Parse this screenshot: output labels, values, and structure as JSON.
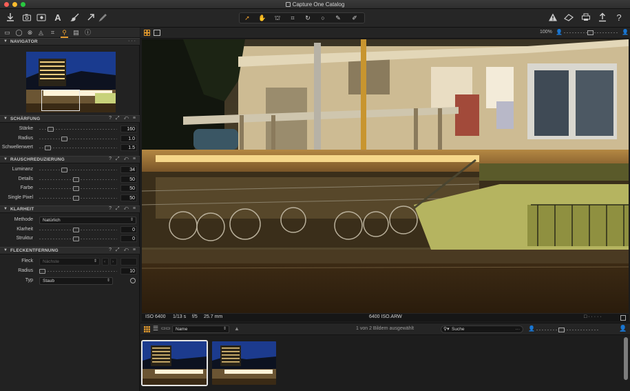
{
  "window": {
    "title": "Capture One Catalog"
  },
  "toolbar": {
    "left_icons": [
      "import-icon",
      "camera-icon",
      "capture-icon",
      "text-icon",
      "brush-icon",
      "arrow-icon",
      "pipette-icon"
    ],
    "center_tools": [
      "select-icon",
      "hand-icon",
      "straighten-icon",
      "crop-icon",
      "rotate-icon",
      "circle-icon",
      "picker-icon",
      "brush-tool-icon"
    ],
    "right_icons": [
      "warning-icon",
      "eraser-icon",
      "print-icon",
      "share-icon",
      "help-icon"
    ]
  },
  "left_panel": {
    "tab_icons": [
      "folder-icon",
      "capture-tab-icon",
      "color-icon",
      "exposure-icon",
      "lens-icon",
      "details-icon",
      "adjustments-icon",
      "metadata-icon"
    ],
    "navigator": {
      "title": "NAVIGATOR"
    },
    "sharpening": {
      "title": "SCHÄRFUNG",
      "rows": [
        {
          "label": "Stärke",
          "value": "160"
        },
        {
          "label": "Radius",
          "value": "1.0"
        },
        {
          "label": "Schwellenwert",
          "value": "1.5"
        }
      ]
    },
    "noise": {
      "title": "RAUSCHREDUZIERUNG",
      "rows": [
        {
          "label": "Luminanz",
          "value": "34"
        },
        {
          "label": "Details",
          "value": "50"
        },
        {
          "label": "Farbe",
          "value": "50"
        },
        {
          "label": "Single Pixel",
          "value": "50"
        }
      ]
    },
    "clarity": {
      "title": "KLARHEIT",
      "method_label": "Methode",
      "method_value": "Natürlich",
      "rows": [
        {
          "label": "Klarheit",
          "value": "0"
        },
        {
          "label": "Struktur",
          "value": "0"
        }
      ]
    },
    "spot": {
      "title": "FLECKENTFERNUNG",
      "fleck_label": "Fleck",
      "fleck_value": "Nächste",
      "radius_label": "Radius",
      "radius_value": "10",
      "type_label": "Typ",
      "type_value": "Staub"
    }
  },
  "viewer": {
    "zoom": "100%",
    "info": {
      "iso": "ISO 6400",
      "shutter": "1/13 s",
      "aperture": "f/5",
      "focal": "25.7 mm",
      "filename": "6400 ISO.ARW"
    }
  },
  "browser": {
    "sort_value": "Name",
    "status": "1 von 2 Bildern ausgewählt",
    "search_placeholder": "Suche"
  },
  "colors": {
    "accent": "#e39a2d",
    "panel": "#222222",
    "titlebar": "#333333"
  }
}
